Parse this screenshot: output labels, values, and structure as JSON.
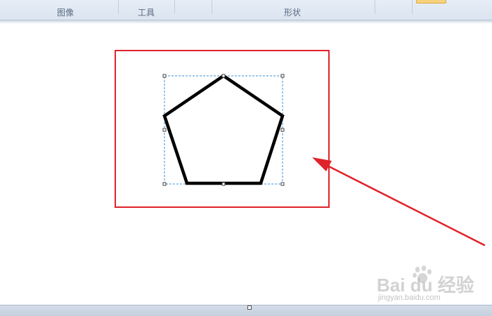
{
  "ribbon": {
    "groups": [
      {
        "label": "图像"
      },
      {
        "label": "工具"
      },
      {
        "label": "形状"
      }
    ]
  },
  "watermark": {
    "brand": "Bai du 经验",
    "url": "jingyan.baidu.com"
  },
  "colors": {
    "annotation_red": "#e0222a",
    "selection_blue": "#3d8fd6",
    "shape_stroke": "#000000",
    "ribbon_bg": "#dbe4f0"
  },
  "icons": {
    "watermark_logo": "paw-icon"
  }
}
